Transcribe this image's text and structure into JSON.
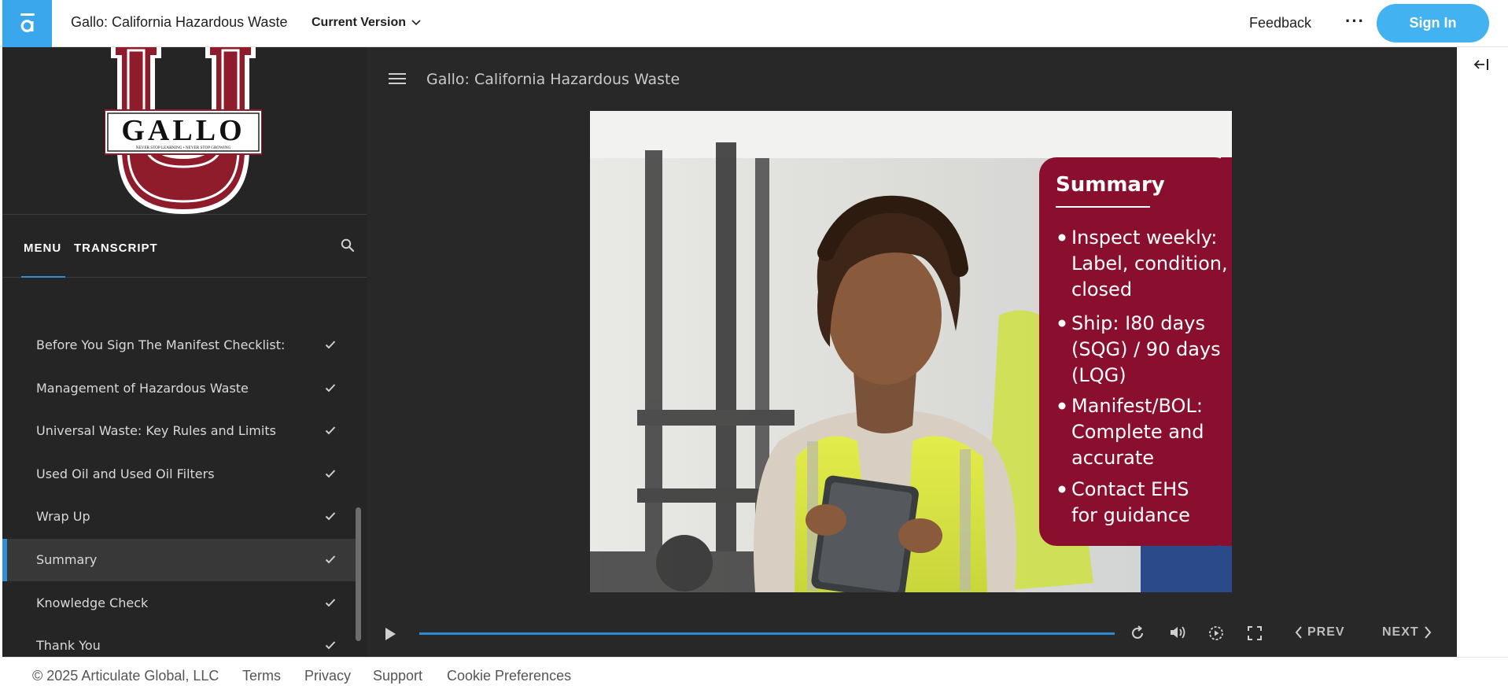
{
  "header": {
    "course_title": "Gallo: California Hazardous Waste",
    "version_label": "Current Version",
    "feedback_label": "Feedback",
    "more_label": "···",
    "signin_label": "Sign In",
    "accent_color": "#42b2f0"
  },
  "sidebar": {
    "logo": {
      "wordmark": "GALLO",
      "tagline": "NEVER STOP LEARNING • NEVER STOP GROWING",
      "color": "#8e1c2b"
    },
    "tabs": [
      {
        "label": "MENU",
        "active": true
      },
      {
        "label": "TRANSCRIPT",
        "active": false
      }
    ],
    "menu_items": [
      {
        "label": "Before You Sign The Manifest Checklist:",
        "completed": true,
        "active": false
      },
      {
        "label": "Management of Hazardous Waste",
        "completed": true,
        "active": false
      },
      {
        "label": "Universal Waste: Key Rules and Limits",
        "completed": true,
        "active": false
      },
      {
        "label": "Used Oil and Used Oil Filters",
        "completed": true,
        "active": false
      },
      {
        "label": "Wrap Up",
        "completed": true,
        "active": false
      },
      {
        "label": "Summary",
        "completed": true,
        "active": true
      },
      {
        "label": "Knowledge Check",
        "completed": true,
        "active": false
      },
      {
        "label": "Thank You",
        "completed": true,
        "active": false
      }
    ]
  },
  "main": {
    "lesson_title": "Gallo: California Hazardous Waste",
    "slide": {
      "heading": "Summary",
      "bullets": [
        [
          "Inspect weekly:",
          "Label, condition,",
          "closed"
        ],
        [
          "Ship: I80 days",
          "(SQG) / 90 days",
          "(LQG)"
        ],
        [
          "Manifest/BOL:",
          "Complete and",
          "accurate"
        ],
        [
          "Contact EHS",
          "for guidance"
        ]
      ],
      "panel_color": "#8a0f2e"
    },
    "controls": {
      "prev_label": "PREV",
      "next_label": "NEXT",
      "progress": 1.0
    }
  },
  "footer": {
    "copyright": "© 2025 Articulate Global, LLC",
    "links": [
      "Terms",
      "Privacy",
      "Support",
      "Cookie Preferences"
    ]
  }
}
